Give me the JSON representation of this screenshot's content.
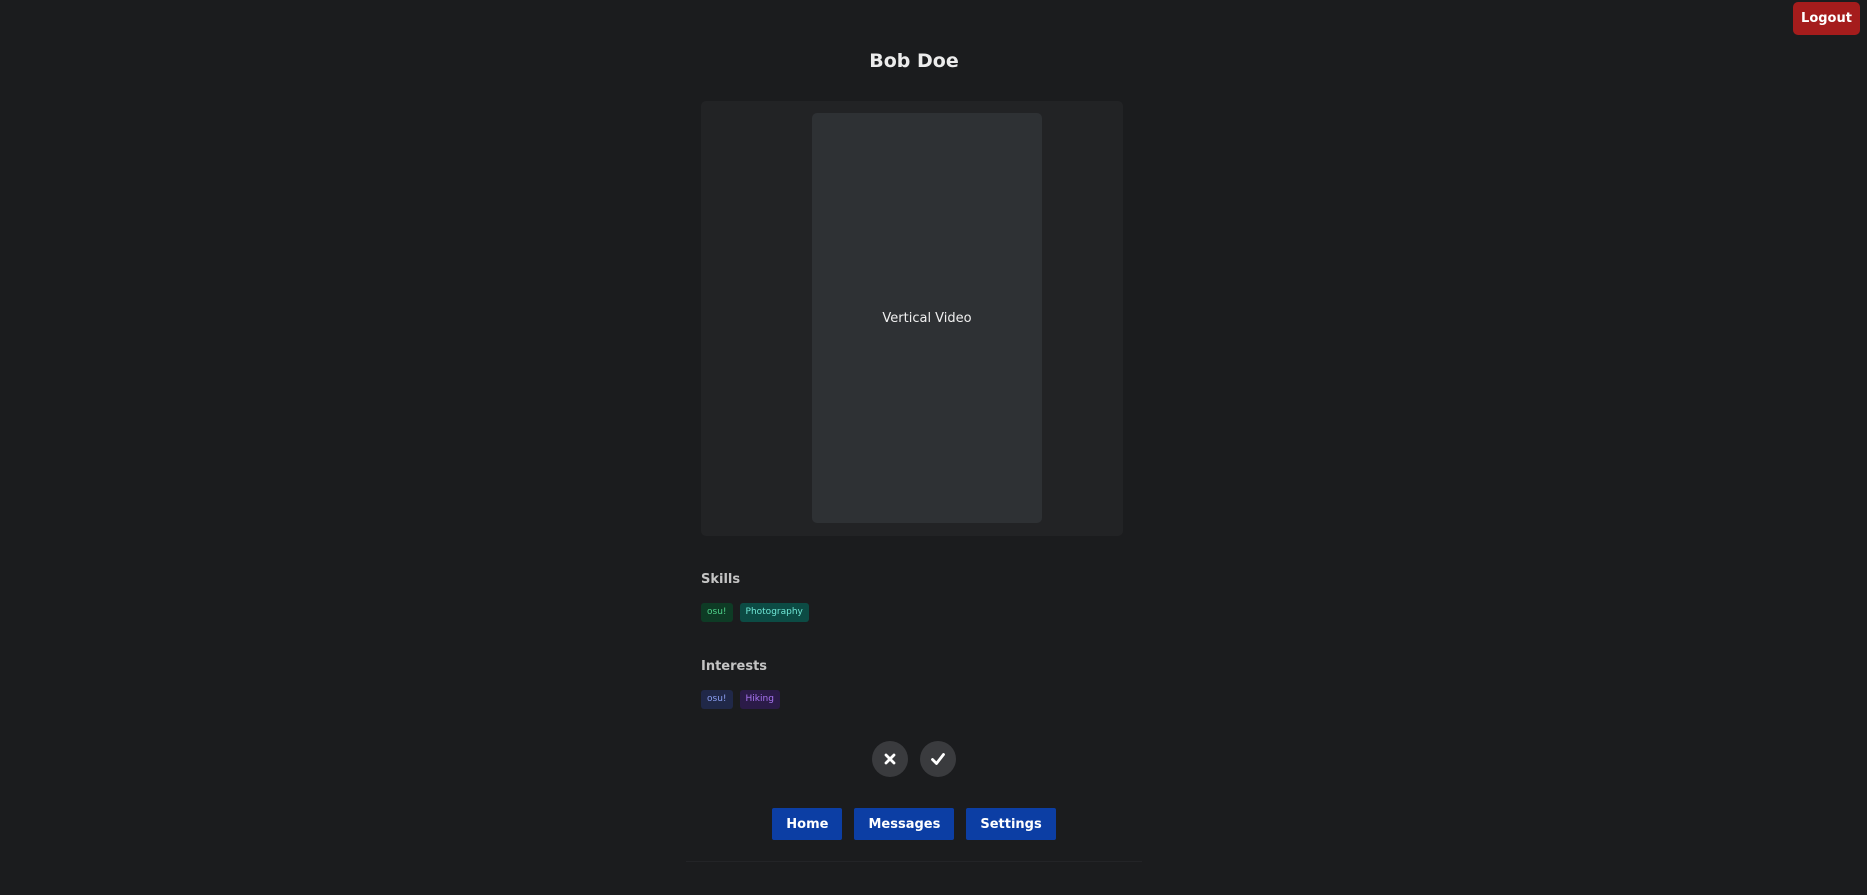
{
  "header": {
    "logout_label": "Logout"
  },
  "profile": {
    "name": "Bob Doe",
    "video_label": "Vertical Video",
    "skills_title": "Skills",
    "skills": [
      "osu!",
      "Photography"
    ],
    "interests_title": "Interests",
    "interests": [
      "osu!",
      "Hiking"
    ]
  },
  "actions": {
    "reject_icon": "close-icon",
    "accept_icon": "check-icon"
  },
  "nav": {
    "home": "Home",
    "messages": "Messages",
    "settings": "Settings"
  },
  "colors": {
    "background": "#1b1c1e",
    "logout": "#a51c1c",
    "nav_button": "#0c3ea4"
  }
}
